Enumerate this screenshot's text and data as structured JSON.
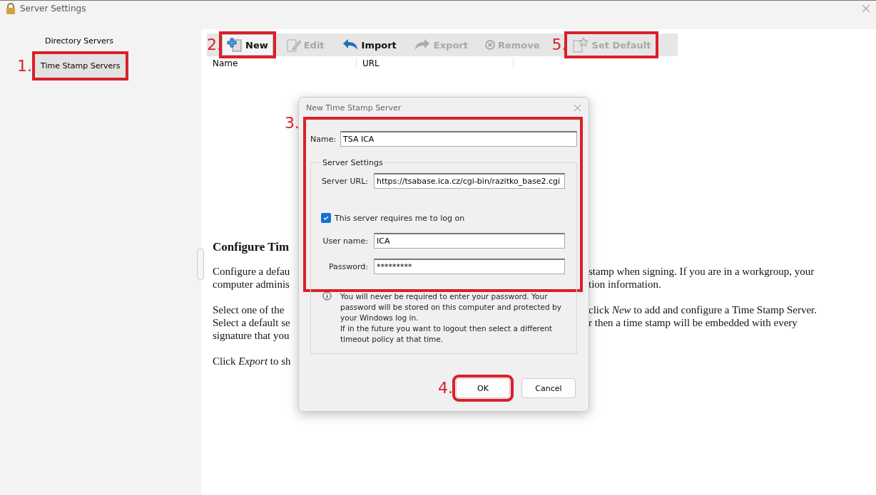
{
  "window": {
    "title": "Server Settings"
  },
  "sidebar": {
    "items": [
      {
        "label": "Directory Servers",
        "selected": false
      },
      {
        "label": "Time Stamp Servers",
        "selected": true,
        "callout": "1."
      }
    ]
  },
  "toolbar": [
    {
      "kind": "new",
      "label": "New",
      "disabled": false,
      "pressed": true,
      "callout": "2."
    },
    {
      "kind": "edit",
      "label": "Edit",
      "disabled": true,
      "pressed": false
    },
    {
      "kind": "import",
      "label": "Import",
      "disabled": false,
      "pressed": false
    },
    {
      "kind": "export",
      "label": "Export",
      "disabled": true,
      "pressed": false
    },
    {
      "kind": "remove",
      "label": "Remove",
      "disabled": true,
      "pressed": false
    },
    {
      "kind": "default",
      "label": "Set Default",
      "disabled": true,
      "pressed": false,
      "callout": "5."
    }
  ],
  "table": {
    "columns": [
      "Name",
      "URL"
    ]
  },
  "body": {
    "heading": "Configure Tim",
    "paragraphs": [
      [
        {
          "left": "Configure a defau",
          "right": "stamp when signing. If you are in a workgroup, your"
        },
        {
          "left": "computer adminis",
          "right": "tion information."
        }
      ],
      [
        {
          "left": "Select one of the",
          "right": "click *New* to add and configure a Time Stamp Server."
        },
        {
          "left": "Select a default se",
          "right": "r then a time stamp will be embedded with every"
        },
        {
          "left": "signature that you"
        }
      ],
      [
        {
          "left": "Click *Export* to sh"
        }
      ]
    ]
  },
  "dialog": {
    "title": "New Time Stamp Server",
    "callout": "3.",
    "name": {
      "label": "Name:",
      "value": "TSA ICA"
    },
    "group": {
      "title": "Server Settings",
      "url": {
        "label": "Server URL:",
        "value": "https://tsabase.ica.cz/cgi-bin/razitko_base2.cgi"
      },
      "login": {
        "label": "This server requires me to log on",
        "checked": true
      },
      "username": {
        "label": "User name:",
        "value": "ICA"
      },
      "password": {
        "label": "Password:",
        "value": "*********"
      },
      "info": [
        "You will never be required to enter your password. Your password will be stored on this computer and protected by your Windows log in.",
        "If in the future you want to logout then select a different timeout policy at that time."
      ]
    },
    "buttons": [
      {
        "label": "OK",
        "callout": "4."
      },
      {
        "label": "Cancel"
      }
    ]
  }
}
